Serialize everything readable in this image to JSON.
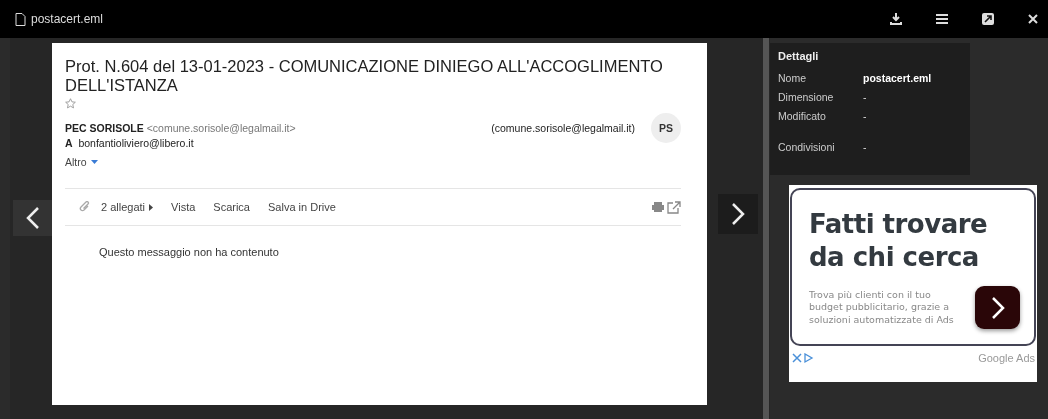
{
  "viewer_bar": {
    "file_name": "postacert.eml"
  },
  "message": {
    "subject": "Prot. N.604 del 13-01-2023 - COMUNICAZIONE DINIEGO ALL'ACCOGLIMENTO DELL'ISTANZA",
    "starred": false,
    "sender_name": "PEC SORISOLE",
    "sender_address": "<comune.sorisole@legalmail.it>",
    "sender_right": "(comune.sorisole@legalmail.it)",
    "avatar_initials": "PS",
    "to_label": "A",
    "to_address": "bonfantioliviero@libero.it",
    "more": "Altro",
    "attachments": "2 allegati",
    "actions": [
      "Vista",
      "Scarica",
      "Salva in Drive"
    ],
    "body": "Questo messaggio non ha contenuto"
  },
  "details": {
    "title": "Dettagli",
    "rows": [
      {
        "label": "Nome",
        "value": "postacert.eml"
      },
      {
        "label": "Dimensione",
        "value": "-"
      },
      {
        "label": "Modificato",
        "value": "-"
      },
      {
        "label": "Condivisioni",
        "value": "-"
      }
    ]
  },
  "ad": {
    "headline": "Fatti trovare da chi cerca",
    "text": "Trova più clienti con il tuo budget pubblicitario, grazie a soluzioni automatizzate di Ads",
    "footer": "Google Ads"
  }
}
